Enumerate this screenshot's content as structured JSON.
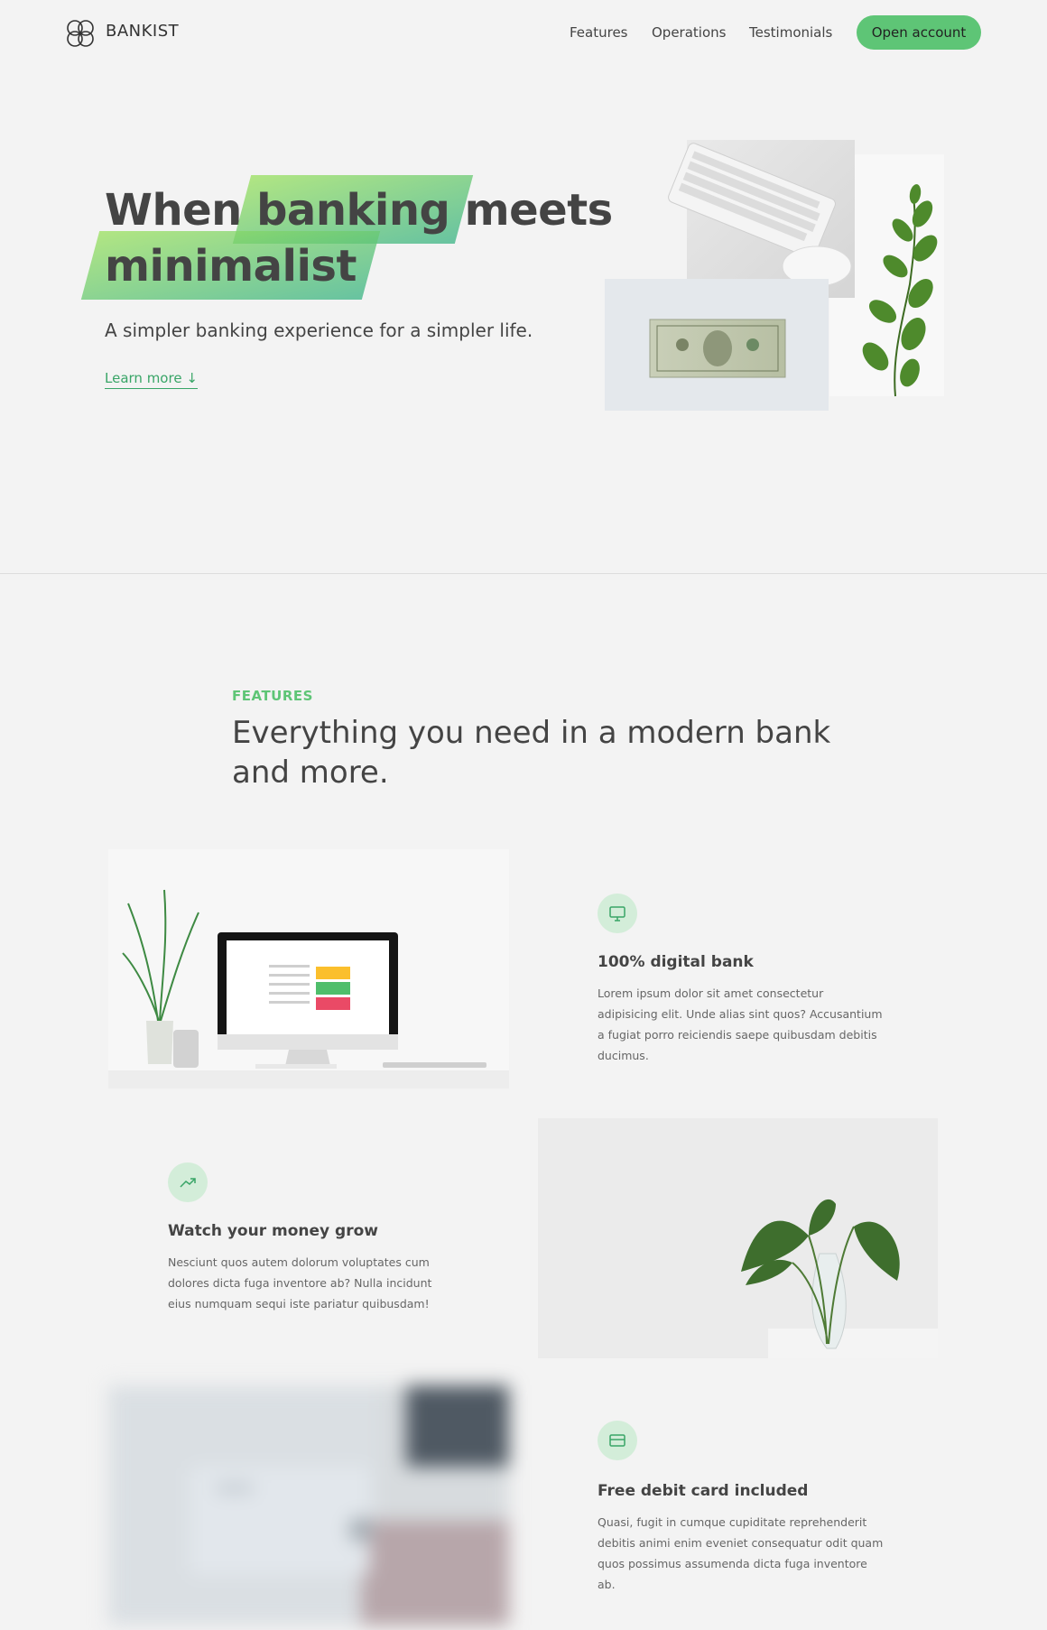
{
  "nav": {
    "brand": "BANKIST",
    "links": [
      "Features",
      "Operations",
      "Testimonials"
    ],
    "cta": "Open account"
  },
  "hero": {
    "title_word1": "When",
    "title_highlight1": "banking",
    "title_word2": "meets",
    "title_highlight2": "minimalist",
    "subtitle": "A simpler banking experience for a simpler life.",
    "learn_more": "Learn more ↓"
  },
  "features": {
    "label": "FEATURES",
    "title": "Everything you need in a modern bank and more.",
    "items": [
      {
        "icon": "monitor-icon",
        "title": "100% digital bank",
        "text": "Lorem ipsum dolor sit amet consectetur adipisicing elit. Unde alias sint quos? Accusantium a fugiat porro reiciendis saepe quibusdam debitis ducimus."
      },
      {
        "icon": "trending-up-icon",
        "title": "Watch your money grow",
        "text": "Nesciunt quos autem dolorum voluptates cum dolores dicta fuga inventore ab? Nulla incidunt eius numquam sequi iste pariatur quibusdam!"
      },
      {
        "icon": "credit-card-icon",
        "title": "Free debit card included",
        "text": "Quasi, fugit in cumque cupiditate reprehenderit debitis animi enim eveniet consequatur odit quam quos possimus assumenda dicta fuga inventore ab."
      }
    ]
  },
  "colors": {
    "accent": "#5ec576",
    "accent_dark": "#39b385",
    "accent_light": "#9be15d",
    "background": "#f3f3f3",
    "text": "#444444"
  }
}
